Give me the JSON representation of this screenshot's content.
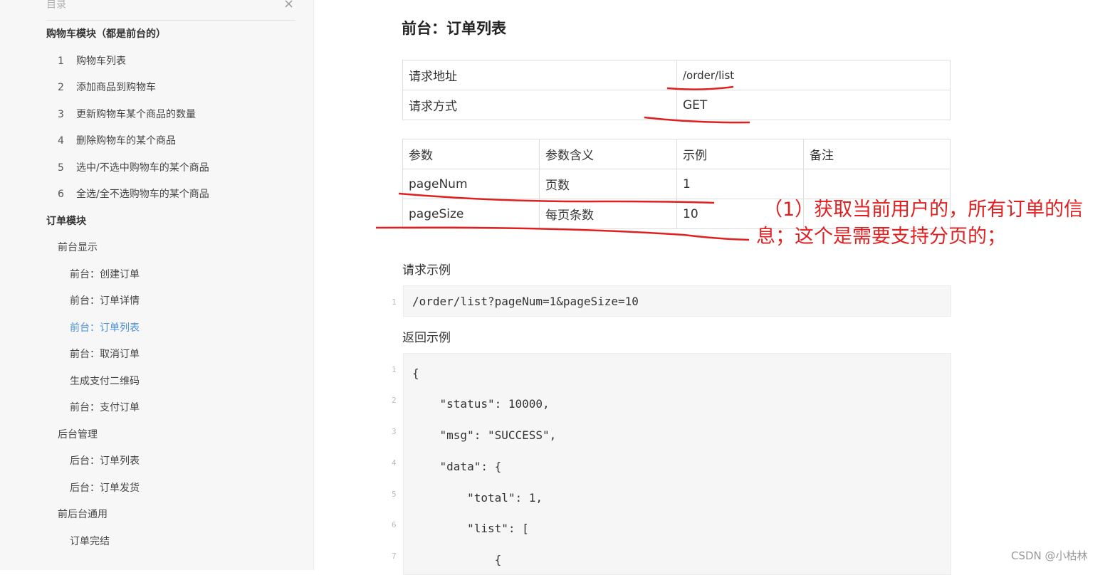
{
  "sidebar": {
    "title": "目录",
    "close_icon": "×",
    "items": [
      {
        "num": "",
        "label": "购物车模块（都是前台的）"
      },
      {
        "num": "1",
        "label": "购物车列表"
      },
      {
        "num": "2",
        "label": "添加商品到购物车"
      },
      {
        "num": "3",
        "label": "更新购物车某个商品的数量"
      },
      {
        "num": "4",
        "label": "删除购物车的某个商品"
      },
      {
        "num": "5",
        "label": "选中/不选中购物车的某个商品"
      },
      {
        "num": "6",
        "label": "全选/全不选购物车的某个商品"
      },
      {
        "num": "",
        "label": "订单模块"
      },
      {
        "num": "",
        "label": "前台显示"
      },
      {
        "num": "",
        "label": "前台：创建订单"
      },
      {
        "num": "",
        "label": "前台：订单详情"
      },
      {
        "num": "",
        "label": "前台：订单列表"
      },
      {
        "num": "",
        "label": "前台：取消订单"
      },
      {
        "num": "",
        "label": "生成支付二维码"
      },
      {
        "num": "",
        "label": "前台：支付订单"
      },
      {
        "num": "",
        "label": "后台管理"
      },
      {
        "num": "",
        "label": "后台：订单列表"
      },
      {
        "num": "",
        "label": "后台：订单发货"
      },
      {
        "num": "",
        "label": "前后台通用"
      },
      {
        "num": "",
        "label": "订单完结"
      }
    ]
  },
  "main": {
    "title": "前台：订单列表",
    "request_table": [
      {
        "key": "请求地址",
        "value": "/order/list"
      },
      {
        "key": "请求方式",
        "value": "GET"
      }
    ],
    "param_headers": [
      "参数",
      "参数含义",
      "示例",
      "备注"
    ],
    "params": [
      {
        "name": "pageNum",
        "meaning": "页数",
        "example": "1",
        "note": ""
      },
      {
        "name": "pageSize",
        "meaning": "每页条数",
        "example": "10",
        "note": ""
      }
    ],
    "request_example_label": "请求示例",
    "request_example": {
      "line_no": "1",
      "code": "/order/list?pageNum=1&pageSize=10"
    },
    "response_example_label": "返回示例",
    "response_lines": [
      {
        "no": "1",
        "code": "{"
      },
      {
        "no": "2",
        "code": "    \"status\": 10000,"
      },
      {
        "no": "3",
        "code": "    \"msg\": \"SUCCESS\","
      },
      {
        "no": "4",
        "code": "    \"data\": {"
      },
      {
        "no": "5",
        "code": "        \"total\": 1,"
      },
      {
        "no": "6",
        "code": "        \"list\": ["
      },
      {
        "no": "7",
        "code": "            {"
      }
    ]
  },
  "annotation": {
    "line1": "（1）获取当前用户的，所有订单的信",
    "line2": "息；这个是需要支持分页的；",
    "color": "#e02020"
  },
  "watermark": "CSDN @小枯林",
  "colors": {
    "active_link": "#4a90d9",
    "annotation_red": "#e02020"
  }
}
